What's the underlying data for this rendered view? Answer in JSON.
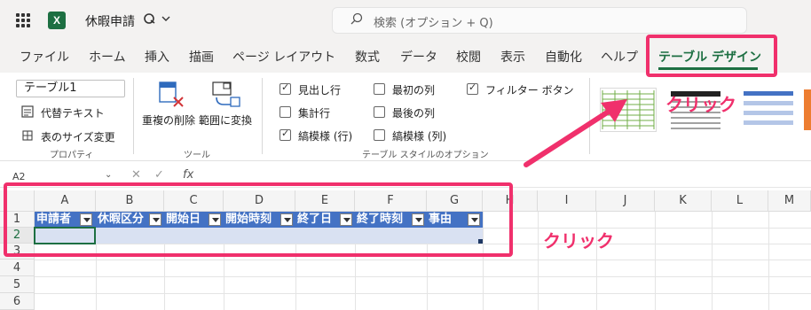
{
  "title": {
    "doc_name": "休暇申請"
  },
  "search": {
    "placeholder": "検索 (オプション + Q)"
  },
  "tabs": [
    "ファイル",
    "ホーム",
    "挿入",
    "描画",
    "ページ レイアウト",
    "数式",
    "データ",
    "校閲",
    "表示",
    "自動化",
    "ヘルプ",
    "テーブル デザイン"
  ],
  "active_tab": "テーブル デザイン",
  "ribbon": {
    "table_name": "テーブル1",
    "alt_text": "代替テキスト",
    "resize": "表のサイズ変更",
    "group_properties": "プロパティ",
    "remove_dup": "重複の削除",
    "convert_range": "範囲に変換",
    "group_tools": "ツール",
    "options": {
      "header_row": "見出し行",
      "total_row": "集計行",
      "banded_rows": "縞模様 (行)",
      "first_col": "最初の列",
      "last_col": "最後の列",
      "banded_cols": "縞模様 (列)",
      "filter_button": "フィルター ボタン"
    },
    "group_style_options": "テーブル スタイルのオプション"
  },
  "formula_bar": {
    "name_box": "A2",
    "fx": "fx"
  },
  "grid": {
    "columns": [
      "A",
      "B",
      "C",
      "D",
      "E",
      "F",
      "G",
      "H",
      "I",
      "J",
      "K",
      "L",
      "M"
    ],
    "rows": [
      "1",
      "2",
      "3",
      "4",
      "5",
      "6"
    ],
    "headers": [
      "申請者",
      "休暇区分",
      "開始日",
      "開始時刻",
      "終了日",
      "終了時刻",
      "事由"
    ]
  },
  "annotations": {
    "click_label_1": "クリック",
    "click_label_2": "クリック"
  },
  "colors": {
    "accent": "#1d6f42",
    "table_header": "#4472c4",
    "table_band": "#d9e1f2",
    "highlight": "#f0306c"
  }
}
